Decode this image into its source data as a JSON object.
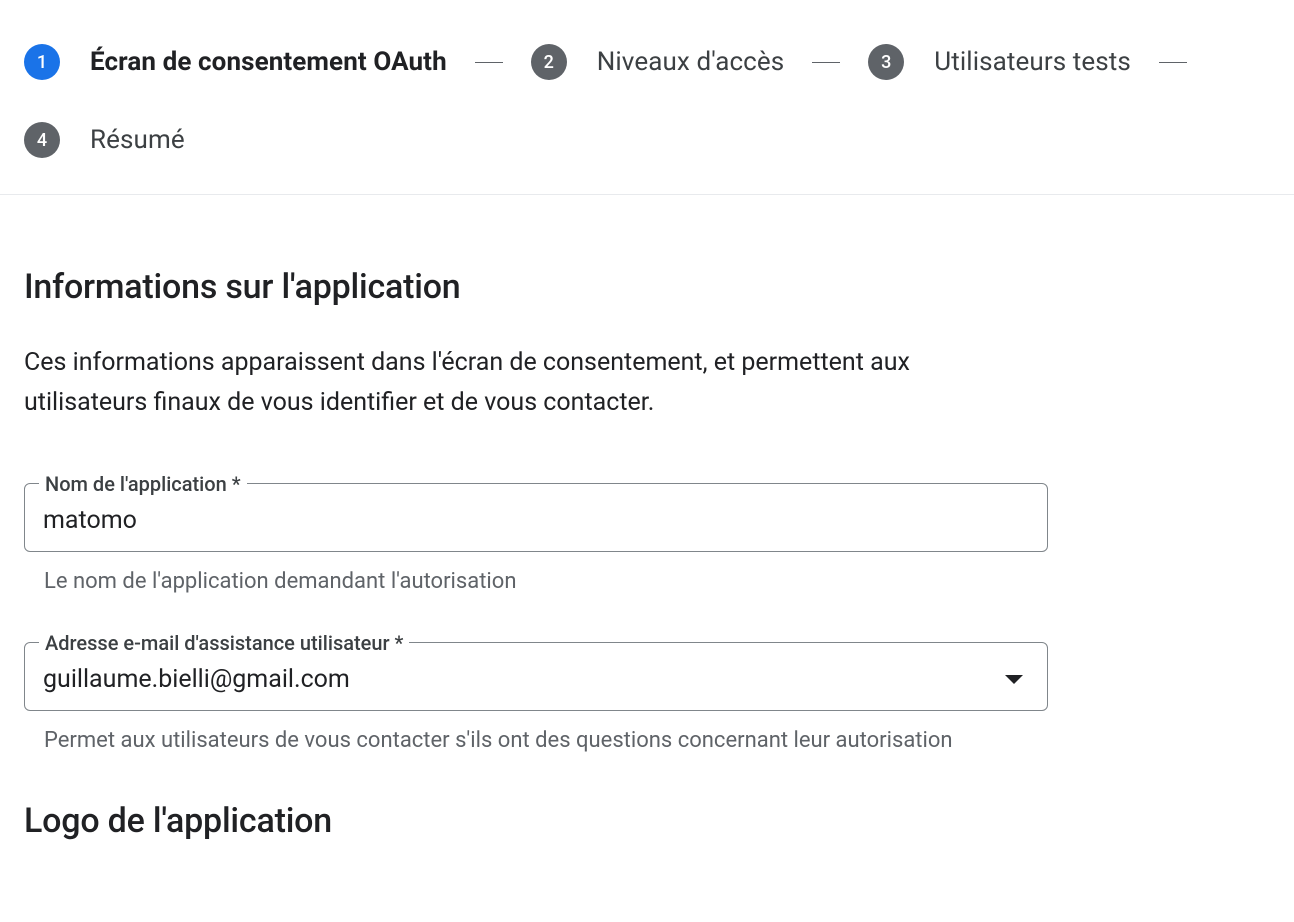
{
  "stepper": {
    "steps": [
      {
        "num": "1",
        "label": "Écran de consentement OAuth",
        "active": true
      },
      {
        "num": "2",
        "label": "Niveaux d'accès",
        "active": false
      },
      {
        "num": "3",
        "label": "Utilisateurs tests",
        "active": false
      },
      {
        "num": "4",
        "label": "Résumé",
        "active": false
      }
    ]
  },
  "section": {
    "title": "Informations sur l'application",
    "desc": "Ces informations apparaissent dans l'écran de consentement, et permettent aux utilisateurs finaux de vous identifier et de vous contacter."
  },
  "fields": {
    "appName": {
      "label": "Nom de l'application *",
      "value": "matomo",
      "help": "Le nom de l'application demandant l'autorisation"
    },
    "supportEmail": {
      "label": "Adresse e-mail d'assistance utilisateur *",
      "value": "guillaume.bielli@gmail.com",
      "help": "Permet aux utilisateurs de vous contacter s'ils ont des questions concernant leur autorisation"
    }
  },
  "logoSection": {
    "title": "Logo de l'application"
  }
}
